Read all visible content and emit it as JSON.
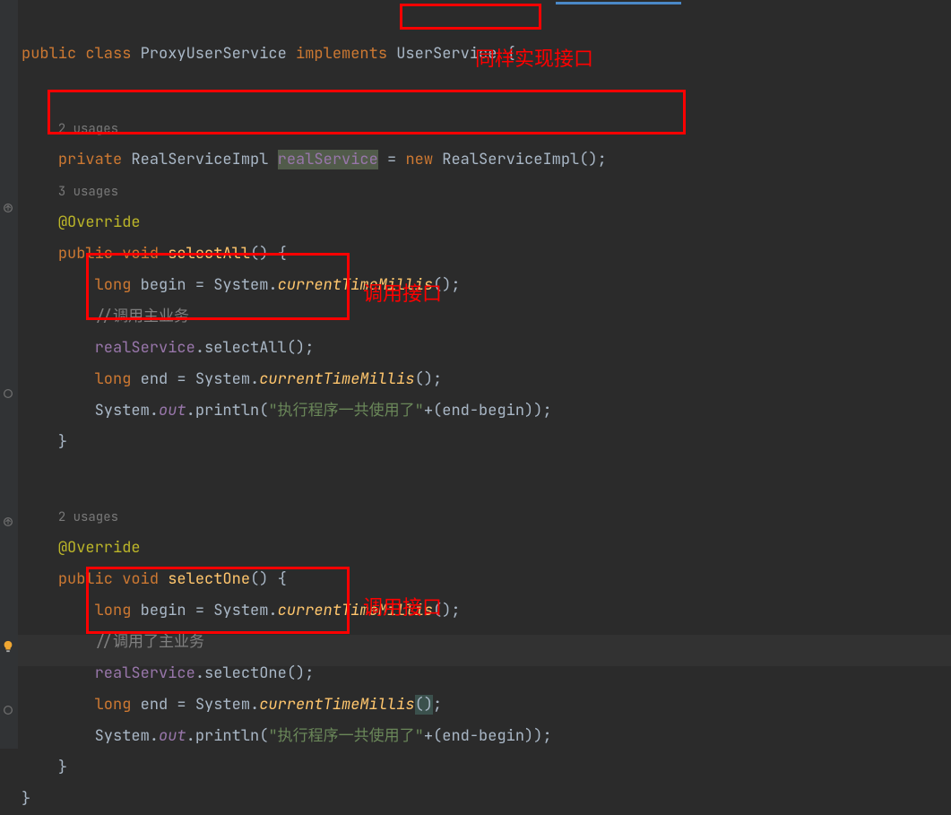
{
  "code": {
    "l1": {
      "kw1": "public",
      "kw2": "class",
      "className": "ProxyUserService",
      "kw3": "implements",
      "iface": "UserService",
      "brace": "{"
    },
    "l3usages": "2 usages",
    "l4": {
      "kw1": "private",
      "type": "RealServiceImpl",
      "field": "realService",
      "eq": " = ",
      "kw2": "new",
      "ctor": "RealServiceImpl",
      "tail": "();"
    },
    "l5usages": "3 usages",
    "override": "@Override",
    "l7": {
      "kw1": "public",
      "kw2": "void",
      "method": "selectAll",
      "tail": "() {"
    },
    "l8": {
      "kw": "long",
      "var": "begin",
      "eq": " = System.",
      "fn": "currentTimeMillis",
      "tail": "();"
    },
    "l9comment": "//调用主业务",
    "l10": {
      "field": "realService",
      "dot": ".",
      "method": "selectAll",
      "tail": "();"
    },
    "l11": {
      "kw": "long",
      "var": "end",
      "eq": " = System.",
      "fn": "currentTimeMillis",
      "tail": "();"
    },
    "l12": {
      "sys": "System.",
      "out": "out",
      "print": ".println(",
      "str": "\"执行程序一共使用了\"",
      "tail": "+(end-begin));"
    },
    "l13": "}",
    "l15usages": "2 usages",
    "l17": {
      "kw1": "public",
      "kw2": "void",
      "method": "selectOne",
      "tail": "() {"
    },
    "l18": {
      "kw": "long",
      "var": "begin",
      "eq": " = System.",
      "fn": "currentTimeMillis",
      "tail": "();"
    },
    "l19comment": "//调用了主业务",
    "l20": {
      "field": "realService",
      "dot": ".",
      "method": "selectOne",
      "tail": "();"
    },
    "l21": {
      "kw": "long",
      "var": "end",
      "eq": " = System.",
      "fn": "currentTimeMillis",
      "tail": "();"
    },
    "l22": {
      "sys": "System.",
      "out": "out",
      "print": ".println(",
      "str": "\"执行程序一共使用了\"",
      "tail": "+(end-begin));"
    },
    "l23": "}",
    "l24": "}"
  },
  "annotations": {
    "a1": "同样实现接口",
    "a2": "调用接口",
    "a3": "调用接口"
  }
}
